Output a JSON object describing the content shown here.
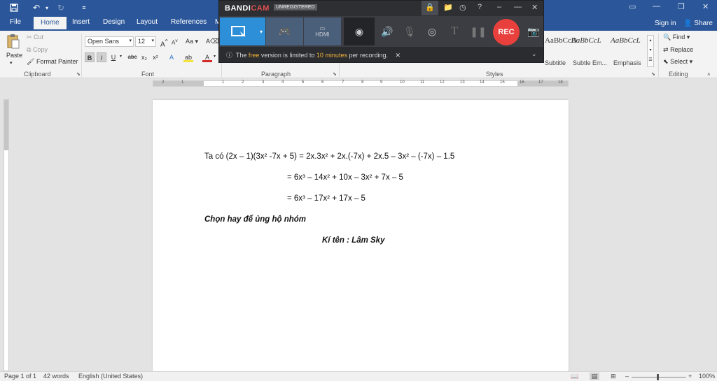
{
  "titlebar": {
    "quick_access": [
      "save-icon",
      "undo-icon",
      "redo-icon",
      "customize-icon"
    ]
  },
  "tabs": {
    "items": [
      "File",
      "Home",
      "Insert",
      "Design",
      "Layout",
      "References",
      "M"
    ],
    "active": "Home",
    "signin": "Sign in",
    "share": "Share"
  },
  "ribbon": {
    "clipboard": {
      "paste": "Paste",
      "cut": "Cut",
      "copy": "Copy",
      "format_painter": "Format Painter",
      "label": "Clipboard"
    },
    "font": {
      "name": "Open Sans",
      "size": "12",
      "grow": "A",
      "shrink": "A",
      "case": "Aa",
      "bold": "B",
      "italic": "I",
      "underline": "U",
      "strike": "abc",
      "subscript": "x₂",
      "superscript": "x²",
      "effects": "A",
      "highlight": "ab",
      "color": "A",
      "label": "Font"
    },
    "paragraph": {
      "label": "Paragraph"
    },
    "styles": {
      "items": [
        {
          "preview": "AaBbCcD",
          "name": "Subtitle"
        },
        {
          "preview": "AaBbCcL",
          "name": "Subtle Em..."
        },
        {
          "preview": "AaBbCcL",
          "name": "Emphasis"
        }
      ],
      "label": "Styles"
    },
    "editing": {
      "find": "Find",
      "replace": "Replace",
      "select": "Select",
      "label": "Editing"
    }
  },
  "bandicam": {
    "logo_main": "BANDI",
    "logo_accent": "CAM",
    "status": "UNREGISTERED",
    "rec_label": "REC",
    "hdmi_label": "HDMI",
    "notice_prefix": "The ",
    "notice_free": "free",
    "notice_mid": " version is limited to ",
    "notice_time": "10 minutes",
    "notice_suffix": " per recording."
  },
  "ruler": {
    "numbers": [
      "2",
      "1",
      "1",
      "2",
      "3",
      "4",
      "5",
      "6",
      "7",
      "8",
      "9",
      "10",
      "11",
      "12",
      "13",
      "14",
      "15",
      "16",
      "17",
      "18"
    ]
  },
  "document": {
    "line1": "Ta có (2x – 1)(3x² -7x + 5) = 2x.3x² + 2x.(-7x) + 2x.5 – 3x² – (-7x) – 1.5",
    "line2": "= 6x³ – 14x² + 10x – 3x² + 7x – 5",
    "line3": "= 6x³ – 17x² + 17x – 5",
    "line4": "Chọn hay để ủng hộ nhóm",
    "line5": "Kí tên : Lâm Sky"
  },
  "statusbar": {
    "page": "Page 1 of 1",
    "words": "42 words",
    "language": "English (United States)",
    "zoom": "100%",
    "zoom_minus": "–",
    "zoom_plus": "+"
  }
}
